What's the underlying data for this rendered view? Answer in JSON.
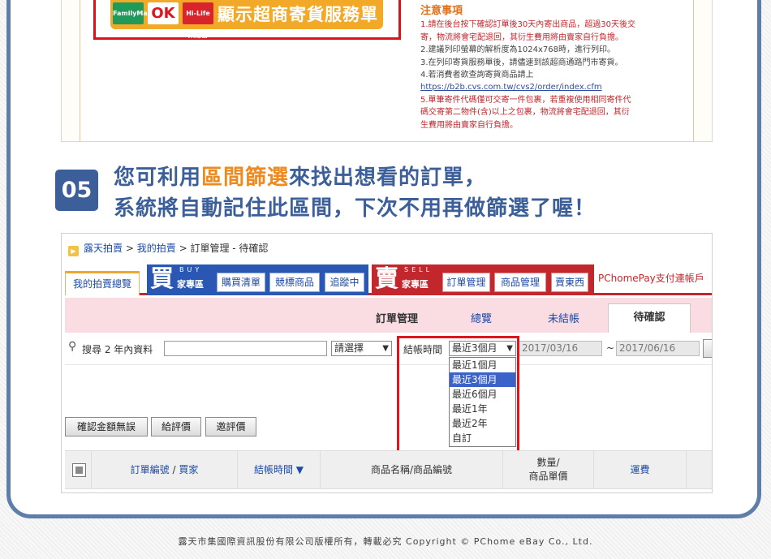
{
  "top": {
    "logos": [
      "FamilyMart",
      "OK",
      "Hi-Life\n萊爾富"
    ],
    "button_label": "顯示超商寄貨服務單",
    "notes": {
      "title": "注意事項",
      "l1a": "1.請在後台按下確認訂單後30天內寄出商品，超過30天後交",
      "l1b": "寄，物流將會宅配退回，其衍生費用將由賣家自行負擔。",
      "l2": "2.建議列印螢幕的解析度為1024x768時，進行列印。",
      "l3": "3.在列印寄貨服務單後，請儘速到該超商通路門市寄貨。",
      "l4": "4.若消費者欲查詢寄貨商品請上",
      "link": "https://b2b.cvs.com.tw/cvs2/order/index.cfm",
      "l5a": "5.單筆寄件代碼僅可交寄一件包裹，若重複使用相同寄件代",
      "l5b": "碼交寄第二物件(含)以上之包裹，物流將會宅配退回，其衍",
      "l5c": "生費用將由賣家自行負擔。"
    }
  },
  "step": {
    "number": "05",
    "line1_a": "您可利用",
    "line1_hl": "區間篩選",
    "line1_b": "來找出想看的訂單，",
    "line2": "系統將自動記住此區間，下次不用再做篩選了喔！"
  },
  "breadcrumb": {
    "b1": "露天拍賣",
    "sep": ">",
    "b2": "我的拍賣",
    "b3": "訂單管理 - 待確認"
  },
  "tabs": {
    "my_auction": "我的拍賣總覽",
    "buy_big": "買",
    "buy_letters": "BUY",
    "buy_small": "家專區",
    "buy_items": [
      "購買清單",
      "競標商品",
      "追蹤中"
    ],
    "sell_big": "賣",
    "sell_letters": "SELL",
    "sell_small": "家專區",
    "sell_items": [
      "訂單管理",
      "商品管理",
      "賣東西"
    ],
    "pchomepay": "PChomePay支付連帳戶"
  },
  "subtabs": {
    "title": "訂單管理",
    "overview": "總覽",
    "unsettled": "未結帳",
    "active": "待確認"
  },
  "filter": {
    "search_label": "搜尋 2 年內資料",
    "search_value": "",
    "select_placeholder": "請選擇",
    "checkout_label": "結帳時間",
    "period_selected": "最近3個月",
    "date_from": "2017/03/16",
    "date_sep": "~",
    "date_to": "2017/06/16",
    "options": [
      "最近1個月",
      "最近3個月",
      "最近6個月",
      "最近1年",
      "最近2年",
      "自訂"
    ]
  },
  "actions": [
    "確認金額無誤",
    "給評價",
    "邀評價"
  ],
  "table": {
    "col_order": "訂單編號",
    "col_sep": "/",
    "col_buyer": "買家",
    "col_time": "結帳時間 ▼",
    "col_name": "商品名稱/商品編號",
    "col_qty1": "數量/",
    "col_qty2": "商品單價",
    "col_ship": "運費"
  },
  "footer": "露天市集國際資訊股份有限公司版權所有，轉載必究 Copyright © PChome eBay Co., Ltd.",
  "colors": {
    "frame": "#5d7ea8",
    "accent_orange": "#ee8a1e",
    "brand_blue": "#3c5f9a",
    "highlight_red": "#e0141d"
  }
}
